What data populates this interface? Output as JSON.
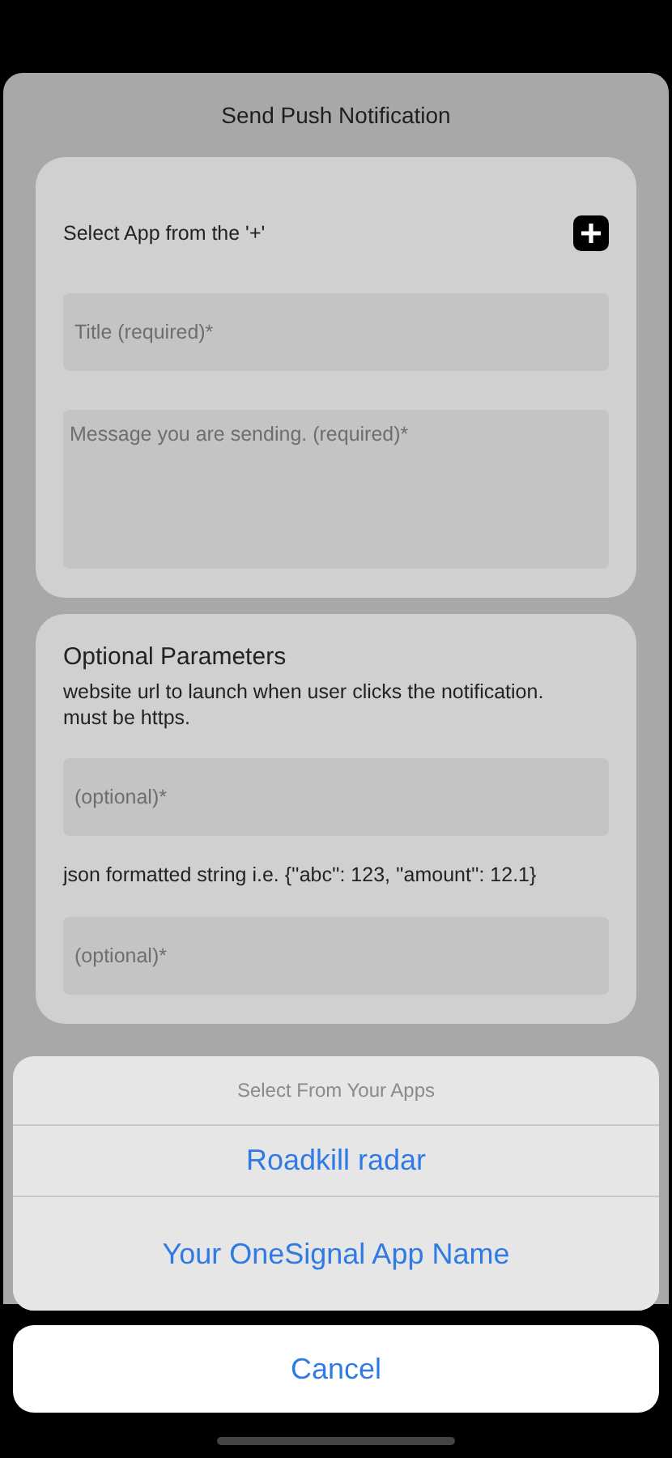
{
  "screen": {
    "title": "Send Push Notification"
  },
  "app_card": {
    "label": "Select App from the '+'",
    "title_field": {
      "placeholder": "Title (required)*"
    },
    "message_field": {
      "placeholder": "Message you are sending. (required)*"
    }
  },
  "optional_card": {
    "heading": "Optional Parameters",
    "url_hint": "website url to launch when user clicks the notification. must be https.",
    "url_field": {
      "placeholder": "(optional)*"
    },
    "json_hint": "json formatted string i.e. {''abc'': 123, ''amount'': 12.1}",
    "json_field": {
      "placeholder": "(optional)*"
    }
  },
  "action_sheet": {
    "title": "Select From Your Apps",
    "options": [
      "Roadkill radar",
      "Your OneSignal App Name"
    ],
    "cancel": "Cancel"
  }
}
